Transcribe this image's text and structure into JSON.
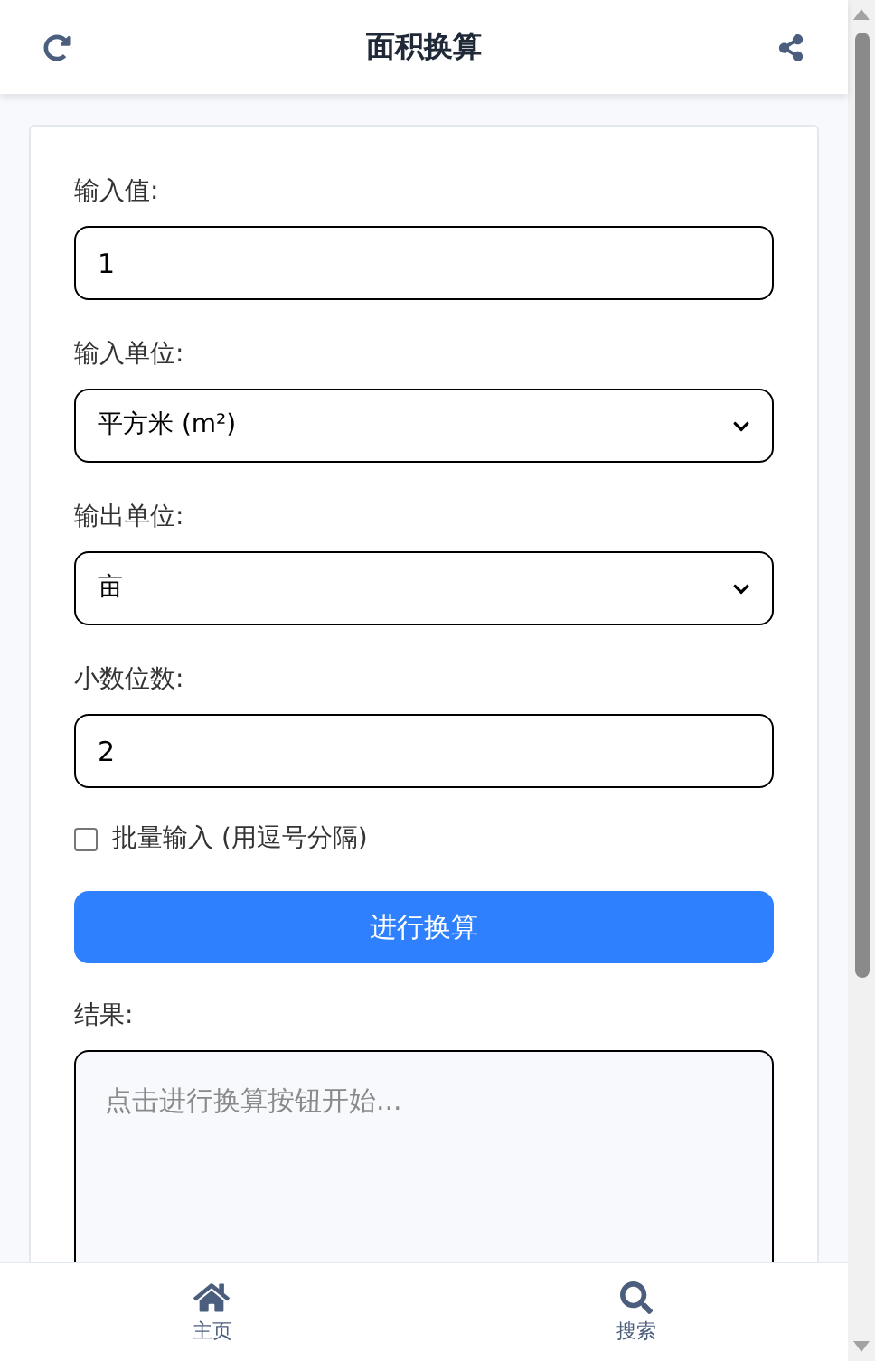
{
  "header": {
    "title": "面积换算"
  },
  "fields": [
    {
      "kind": "input",
      "label": "输入值:",
      "value": "1"
    },
    {
      "kind": "select",
      "label": "输入单位:",
      "value": "平方米 (m²)"
    },
    {
      "kind": "select",
      "label": "输出单位:",
      "value": "亩"
    },
    {
      "kind": "input",
      "label": "小数位数:",
      "value": "2"
    }
  ],
  "batch": {
    "label": "批量输入 (用逗号分隔)",
    "checked": false
  },
  "convert_button": "进行换算",
  "result": {
    "label": "结果:",
    "placeholder": "点击进行换算按钮开始..."
  },
  "bottom_nav": [
    {
      "kind": "home",
      "label": "主页"
    },
    {
      "kind": "search",
      "label": "搜索"
    }
  ]
}
